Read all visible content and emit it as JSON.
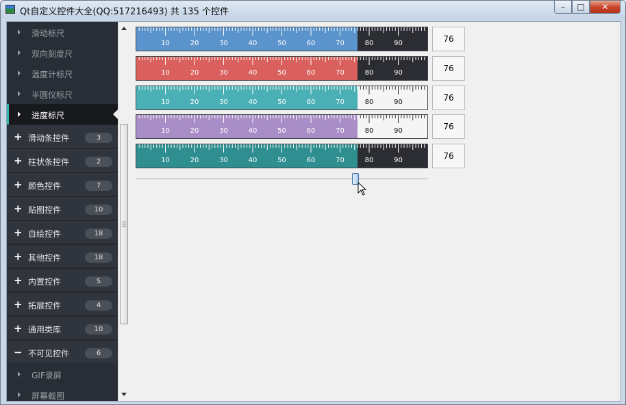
{
  "window": {
    "title": "Qt自定义控件大全(QQ:517216493) 共 135 个控件",
    "buttons": {
      "minimize": "–",
      "maximize": "□",
      "close": "✕"
    }
  },
  "sidebar": {
    "sub_items_top": [
      {
        "label": "滑动标尺"
      },
      {
        "label": "双向刻度尺"
      },
      {
        "label": "温度计标尺"
      },
      {
        "label": "半圆仪标尺"
      },
      {
        "label": "进度标尺",
        "active": true
      }
    ],
    "groups": [
      {
        "icon": "+",
        "label": "滑动条控件",
        "count": "3"
      },
      {
        "icon": "+",
        "label": "柱状条控件",
        "count": "2"
      },
      {
        "icon": "+",
        "label": "颜色控件",
        "count": "7"
      },
      {
        "icon": "+",
        "label": "贴图控件",
        "count": "10"
      },
      {
        "icon": "+",
        "label": "自绘控件",
        "count": "18"
      },
      {
        "icon": "+",
        "label": "其他控件",
        "count": "18"
      },
      {
        "icon": "+",
        "label": "内置控件",
        "count": "5"
      },
      {
        "icon": "+",
        "label": "拓展控件",
        "count": "4"
      },
      {
        "icon": "+",
        "label": "通用类库",
        "count": "10"
      },
      {
        "icon": "−",
        "label": "不可见控件",
        "count": "6"
      }
    ],
    "sub_items_bottom": [
      {
        "label": "GIF录屏"
      },
      {
        "label": "屏幕截图"
      }
    ]
  },
  "rulers": {
    "value": 76,
    "min": 0,
    "max": 100,
    "tick_labels": [
      "10",
      "20",
      "30",
      "40",
      "50",
      "60",
      "70",
      "80",
      "90"
    ],
    "items": [
      {
        "progress_color": "#5b93cc",
        "bg_color": "#2b2d33",
        "ticks": "top"
      },
      {
        "progress_color": "#d9605d",
        "bg_color": "#2b2d33",
        "ticks": "top"
      },
      {
        "progress_color": "#4ab0b6",
        "bg_color": "#f5f5f5",
        "ticks": "top"
      },
      {
        "progress_color": "#a98dc6",
        "bg_color": "#f5f5f5",
        "ticks": "top"
      },
      {
        "progress_color": "#2f8e90",
        "bg_color": "#2b2d33",
        "ticks": "top"
      }
    ],
    "value_labels": [
      "76",
      "76",
      "76",
      "76",
      "76"
    ]
  },
  "slider": {
    "value": 76,
    "min": 0,
    "max": 100
  },
  "colors": {
    "sidebar_bg": "#292d35",
    "sidebar_group_bg": "#30343c",
    "active_accent": "#38b6b0"
  }
}
